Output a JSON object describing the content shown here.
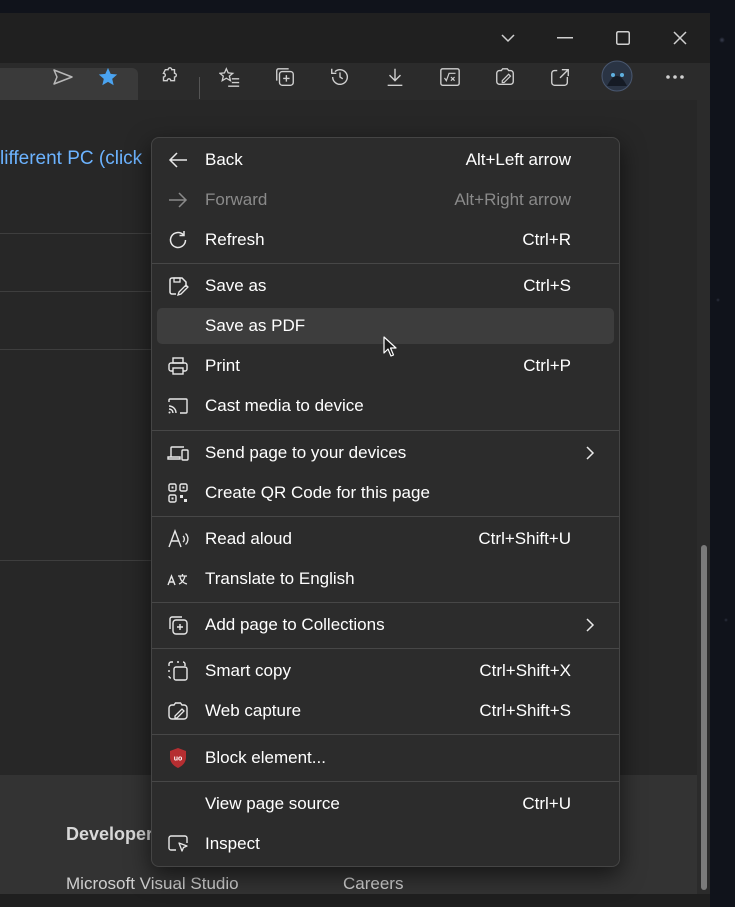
{
  "menu": {
    "items": [
      {
        "label": "Back",
        "shortcut": "Alt+Left arrow",
        "icon": "back-arrow-icon"
      },
      {
        "label": "Forward",
        "shortcut": "Alt+Right arrow",
        "icon": "forward-arrow-icon",
        "disabled": true
      },
      {
        "label": "Refresh",
        "shortcut": "Ctrl+R",
        "icon": "refresh-icon"
      },
      {
        "label": "Save as",
        "shortcut": "Ctrl+S",
        "icon": "save-as-icon"
      },
      {
        "label": "Save as PDF",
        "shortcut": "",
        "highlighted": true
      },
      {
        "label": "Print",
        "shortcut": "Ctrl+P",
        "icon": "print-icon"
      },
      {
        "label": "Cast media to device",
        "shortcut": "",
        "icon": "cast-icon"
      },
      {
        "label": "Send page to your devices",
        "submenu": true,
        "icon": "send-devices-icon"
      },
      {
        "label": "Create QR Code for this page",
        "shortcut": "",
        "icon": "qr-code-icon"
      },
      {
        "label": "Read aloud",
        "shortcut": "Ctrl+Shift+U",
        "icon": "read-aloud-icon"
      },
      {
        "label": "Translate to English",
        "shortcut": "",
        "icon": "translate-icon"
      },
      {
        "label": "Add page to Collections",
        "submenu": true,
        "icon": "collections-icon"
      },
      {
        "label": "Smart copy",
        "shortcut": "Ctrl+Shift+X",
        "icon": "smart-copy-icon"
      },
      {
        "label": "Web capture",
        "shortcut": "Ctrl+Shift+S",
        "icon": "web-capture-icon"
      },
      {
        "label": "Block element...",
        "shortcut": "",
        "icon": "ublock-shield-icon"
      },
      {
        "label": "View page source",
        "shortcut": "Ctrl+U"
      },
      {
        "label": "Inspect",
        "shortcut": "",
        "icon": "inspect-icon"
      }
    ]
  },
  "page": {
    "link_text": "lifferent PC (click",
    "footer_heading": "Developer",
    "footer_link1": "Microsoft Visual Studio",
    "footer_link2": "Careers"
  },
  "colors": {
    "menu_bg": "#2c2c2c",
    "highlight_bg": "#3d3d3d",
    "accent_star": "#4aa3f0",
    "link": "#6cb3ff",
    "ublock_red": "#b52e31"
  }
}
